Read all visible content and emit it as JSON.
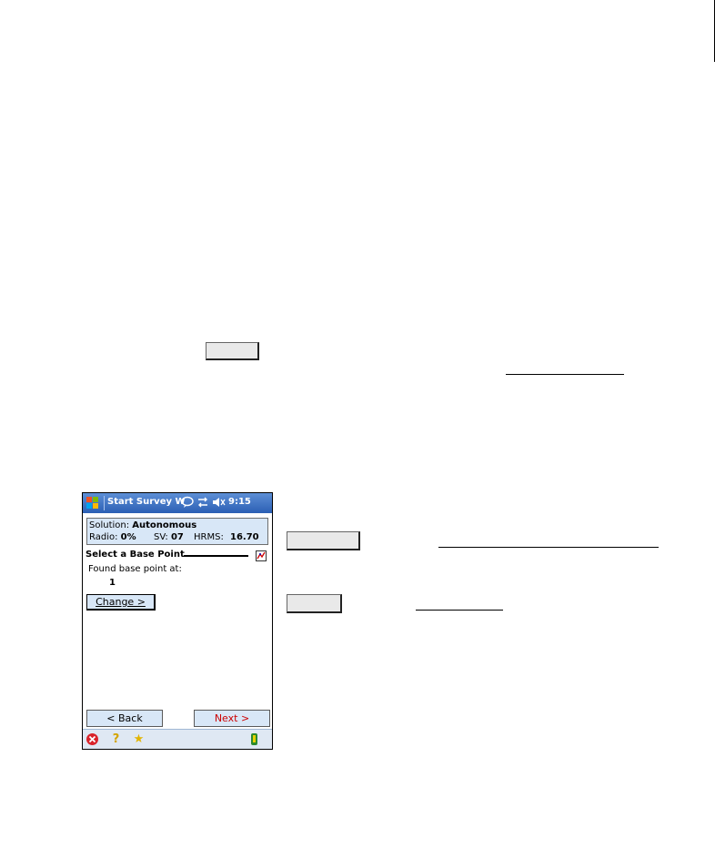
{
  "device": {
    "title": "Start Survey W",
    "time": "9:15",
    "status": {
      "solution_label": "Solution:",
      "solution_value": "Autonomous",
      "radio_label": "Radio:",
      "radio_value": "0%",
      "sv_label": "SV:",
      "sv_value": "07",
      "hrms_label": "HRMS:",
      "hrms_value": "16.70"
    },
    "section_title": "Select a Base Point",
    "found_label": "Found base point at:",
    "found_value": "1",
    "change_button": "Change >",
    "back_button": "< Back",
    "next_button": "Next >"
  },
  "colors": {
    "titlebar": "#2b5fb4",
    "panel": "#d8e7f7",
    "next_text": "#cc0000"
  },
  "icons": [
    "windows-start-icon",
    "message-icon",
    "connectivity-icon",
    "volume-icon",
    "map-icon",
    "close-icon",
    "help-icon",
    "favorites-icon",
    "gps-receiver-icon"
  ]
}
